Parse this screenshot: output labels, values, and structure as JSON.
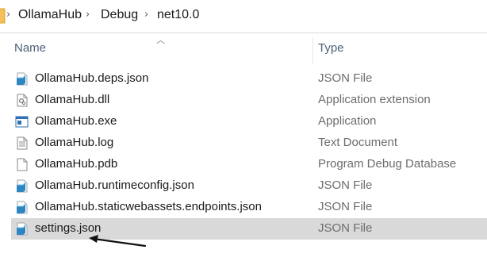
{
  "breadcrumb": {
    "items": [
      "OllamaHub",
      "Debug",
      "net10.0"
    ],
    "separator": "›"
  },
  "columns": {
    "name": "Name",
    "type": "Type",
    "sorted_column": "name"
  },
  "files": [
    {
      "name": "OllamaHub.deps.json",
      "type": "JSON File",
      "icon": "json-file-icon"
    },
    {
      "name": "OllamaHub.dll",
      "type": "Application extension",
      "icon": "dll-file-icon"
    },
    {
      "name": "OllamaHub.exe",
      "type": "Application",
      "icon": "exe-file-icon"
    },
    {
      "name": "OllamaHub.log",
      "type": "Text Document",
      "icon": "text-file-icon"
    },
    {
      "name": "OllamaHub.pdb",
      "type": "Program Debug Database",
      "icon": "blank-file-icon"
    },
    {
      "name": "OllamaHub.runtimeconfig.json",
      "type": "JSON File",
      "icon": "json-file-icon"
    },
    {
      "name": "OllamaHub.staticwebassets.endpoints.json",
      "type": "JSON File",
      "icon": "json-file-icon"
    },
    {
      "name": "settings.json",
      "type": "JSON File",
      "icon": "json-file-icon",
      "selected": true
    }
  ],
  "annotation": {
    "type": "arrow",
    "points_to": "settings.json"
  },
  "colors": {
    "selection": "#d9d9d9",
    "header_text": "#4c607a",
    "type_text": "#6d6d6d",
    "json_icon": "#2e86c1"
  }
}
